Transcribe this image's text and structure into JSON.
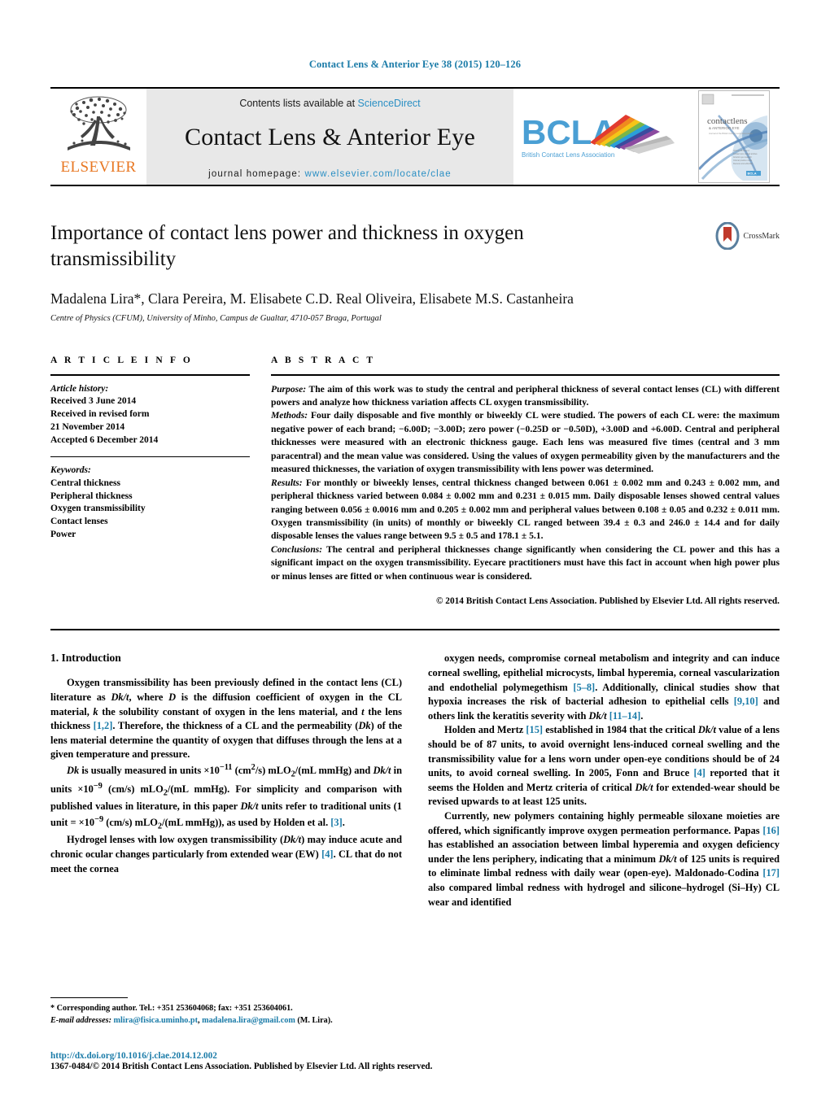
{
  "running_head": "Contact Lens & Anterior Eye 38 (2015) 120–126",
  "masthead": {
    "contents_prefix": "Contents lists available at ",
    "contents_link": "ScienceDirect",
    "journal_title": "Contact Lens & Anterior Eye",
    "homepage_prefix": "journal homepage:",
    "homepage_url": "www.elsevier.com/locate/clae",
    "elsevier_label": "ELSEVIER",
    "tree_icon": "elsevier-tree-icon",
    "bcla_logo_text": "BCLA",
    "bcla_subtitle": "British Contact Lens Association",
    "cover_title": "contactlens",
    "cover_subtitle": "& ANTERIOR EYE",
    "accent_orange": "#e87722",
    "accent_blue": "#2a8fc4"
  },
  "title_block": {
    "title": "Importance of contact lens power and thickness in oxygen transmissibility",
    "authors": "Madalena Lira*, Clara Pereira, M. Elisabete C.D. Real Oliveira, Elisabete M.S. Castanheira",
    "affiliation": "Centre of Physics (CFUM), University of Minho, Campus de Gualtar, 4710-057 Braga, Portugal",
    "crossmark_label": "CrossMark",
    "crossmark_icon": "crossmark-icon"
  },
  "article_info": {
    "heading": "A R T I C L E    I N F O",
    "history_label": "Article history:",
    "history": [
      "Received 3 June 2014",
      "Received in revised form",
      "21 November 2014",
      "Accepted 6 December 2014"
    ],
    "keywords_label": "Keywords:",
    "keywords": [
      "Central thickness",
      "Peripheral thickness",
      "Oxygen transmissibility",
      "Contact lenses",
      "Power"
    ]
  },
  "abstract": {
    "heading": "A B S T R A C T",
    "purpose_label": "Purpose:",
    "purpose_text": " The aim of this work was to study the central and peripheral thickness of several contact lenses (CL) with different powers and analyze how thickness variation affects CL oxygen transmissibility.",
    "methods_label": "Methods:",
    "methods_text": " Four daily disposable and five monthly or biweekly CL were studied. The powers of each CL were: the maximum negative power of each brand; −6.00D; −3.00D; zero power (−0.25D or −0.50D), +3.00D and +6.00D. Central and peripheral thicknesses were measured with an electronic thickness gauge. Each lens was measured five times (central and 3 mm paracentral) and the mean value was considered. Using the values of oxygen permeability given by the manufacturers and the measured thicknesses, the variation of oxygen transmissibility with lens power was determined.",
    "results_label": "Results:",
    "results_text": " For monthly or biweekly lenses, central thickness changed between 0.061 ± 0.002 mm and 0.243 ± 0.002 mm, and peripheral thickness varied between 0.084 ± 0.002 mm and 0.231 ± 0.015 mm. Daily disposable lenses showed central values ranging between 0.056 ± 0.0016 mm and 0.205 ± 0.002 mm and peripheral values between 0.108 ± 0.05 and 0.232 ± 0.011 mm. Oxygen transmissibility (in units) of monthly or biweekly CL ranged between 39.4 ± 0.3 and 246.0 ± 14.4 and for daily disposable lenses the values range between 9.5 ± 0.5 and 178.1 ± 5.1.",
    "conclusions_label": "Conclusions:",
    "conclusions_text": " The central and peripheral thicknesses change significantly when considering the CL power and this has a significant impact on the oxygen transmissibility. Eyecare practitioners must have this fact in account when high power plus or minus lenses are fitted or when continuous wear is considered.",
    "copyright": "© 2014 British Contact Lens Association. Published by Elsevier Ltd. All rights reserved."
  },
  "body": {
    "section_title": "1.  Introduction",
    "left_paragraphs": [
      {
        "segments": [
          {
            "t": "Oxygen transmissibility has been previously defined in the contact lens (CL) literature as "
          },
          {
            "t": "Dk/t",
            "s": "it"
          },
          {
            "t": ", where "
          },
          {
            "t": "D",
            "s": "it"
          },
          {
            "t": " is the diffusion coefficient of oxygen in the CL material, "
          },
          {
            "t": "k",
            "s": "it"
          },
          {
            "t": " the solubility constant of oxygen in the lens material, and "
          },
          {
            "t": "t",
            "s": "it"
          },
          {
            "t": " the lens thickness "
          },
          {
            "t": "[1,2]",
            "s": "cite"
          },
          {
            "t": ". Therefore, the thickness of a CL and the permeability ("
          },
          {
            "t": "Dk",
            "s": "it"
          },
          {
            "t": ") of the lens material determine the quantity of oxygen that diffuses through the lens at a given temperature and pressure."
          }
        ]
      },
      {
        "segments": [
          {
            "t": "Dk",
            "s": "it"
          },
          {
            "t": " is usually measured in units ×10"
          },
          {
            "t": "−11",
            "s": "sup"
          },
          {
            "t": " (cm"
          },
          {
            "t": "2",
            "s": "sup"
          },
          {
            "t": "/s) mLO"
          },
          {
            "t": "2",
            "s": "sub"
          },
          {
            "t": "/(mL mmHg) and "
          },
          {
            "t": "Dk/t",
            "s": "it"
          },
          {
            "t": " in units ×10"
          },
          {
            "t": "−9",
            "s": "sup"
          },
          {
            "t": " (cm/s) mLO"
          },
          {
            "t": "2",
            "s": "sub"
          },
          {
            "t": "/(mL mmHg). For simplicity and comparison with published values in literature, in this paper "
          },
          {
            "t": "Dk/t",
            "s": "it"
          },
          {
            "t": " units refer to traditional units (1 unit = ×10"
          },
          {
            "t": "−9",
            "s": "sup"
          },
          {
            "t": " (cm/s) mLO"
          },
          {
            "t": "2",
            "s": "sub"
          },
          {
            "t": "/(mL mmHg)), as used by Holden et al. "
          },
          {
            "t": "[3]",
            "s": "cite"
          },
          {
            "t": "."
          }
        ]
      },
      {
        "segments": [
          {
            "t": "Hydrogel lenses with low oxygen transmissibility ("
          },
          {
            "t": "Dk/t",
            "s": "it"
          },
          {
            "t": ") may induce acute and chronic ocular changes particularly from extended wear (EW) "
          },
          {
            "t": "[4]",
            "s": "cite"
          },
          {
            "t": ". CL that do not meet the cornea"
          }
        ]
      }
    ],
    "right_paragraphs": [
      {
        "segments": [
          {
            "t": "oxygen needs, compromise corneal metabolism and integrity and can induce corneal swelling, epithelial microcysts, limbal hyperemia, corneal vascularization and endothelial polymegethism "
          },
          {
            "t": "[5–8]",
            "s": "cite"
          },
          {
            "t": ". Additionally, clinical studies show that hypoxia increases the risk of bacterial adhesion to epithelial cells "
          },
          {
            "t": "[9,10]",
            "s": "cite"
          },
          {
            "t": " and others link the keratitis severity with "
          },
          {
            "t": "Dk/t",
            "s": "it"
          },
          {
            "t": " "
          },
          {
            "t": "[11–14]",
            "s": "cite"
          },
          {
            "t": "."
          }
        ],
        "noindent": false
      },
      {
        "segments": [
          {
            "t": "Holden and Mertz "
          },
          {
            "t": "[15]",
            "s": "cite"
          },
          {
            "t": " established in 1984 that the critical "
          },
          {
            "t": "Dk/t",
            "s": "it"
          },
          {
            "t": " value of a lens should be of 87 units, to avoid overnight lens-induced corneal swelling and the transmissibility value for a lens worn under open-eye conditions should be of 24 units, to avoid corneal swelling. In 2005, Fonn and Bruce "
          },
          {
            "t": "[4]",
            "s": "cite"
          },
          {
            "t": " reported that it seems the Holden and Mertz criteria of critical "
          },
          {
            "t": "Dk/t",
            "s": "it"
          },
          {
            "t": " for extended-wear should be revised upwards to at least 125 units."
          }
        ]
      },
      {
        "segments": [
          {
            "t": "Currently, new polymers containing highly permeable siloxane moieties are offered, which significantly improve oxygen permeation performance. Papas "
          },
          {
            "t": "[16]",
            "s": "cite"
          },
          {
            "t": " has established an association between limbal hyperemia and oxygen deficiency under the lens periphery, indicating that a minimum "
          },
          {
            "t": "Dk/t",
            "s": "it"
          },
          {
            "t": " of 125 units is required to eliminate limbal redness with daily wear (open-eye). Maldonado-Codina "
          },
          {
            "t": "[17]",
            "s": "cite"
          },
          {
            "t": " also compared limbal redness with hydrogel and silicone–hydrogel (Si–Hy) CL wear and identified"
          }
        ]
      }
    ]
  },
  "footnotes": {
    "corresponding": "*  Corresponding author. Tel.: +351 253604068; fax: +351 253604061.",
    "email_label": "E-mail addresses:",
    "email1": "mlira@fisica.uminho.pt",
    "email_sep": ", ",
    "email2": "madalena.lira@gmail.com",
    "email_suffix": " (M. Lira)."
  },
  "bottom": {
    "doi": "http://dx.doi.org/10.1016/j.clae.2014.12.002",
    "issn": "1367-0484/© 2014 British Contact Lens Association. Published by Elsevier Ltd. All rights reserved."
  }
}
